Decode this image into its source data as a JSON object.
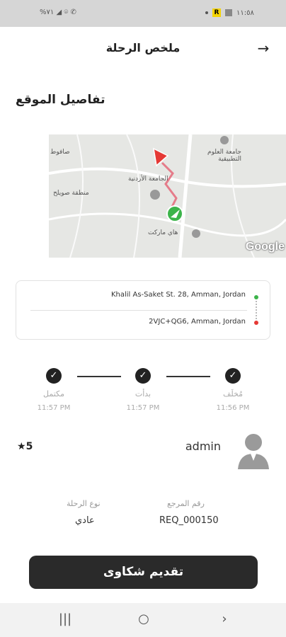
{
  "status_bar": {
    "time": "١١:٥٨",
    "left_indicators": "%٧١ ◢ ⌾ ✆"
  },
  "header": {
    "title": "ملخص الرحلة",
    "back_icon": "arrow-right-icon"
  },
  "location_section": {
    "title": "تفاصيل الموقع"
  },
  "map": {
    "labels": {
      "university_sci": "جامعة العلوم التطبيقية",
      "university_jordan": "الجامعة الأردنية",
      "sweileh": "منطقة صويلح",
      "safout": "صافوط",
      "hi_market": "هاي ماركت"
    },
    "attribution": "Google"
  },
  "route": {
    "pickup": "Khalil As-Saket St. 28, Amman, Jordan",
    "dropoff": "2VJC+QG6, Amman, Jordan",
    "pickup_color": "#3cb44a",
    "dropoff_color": "#e53935"
  },
  "steps": [
    {
      "label": "مُخلَف",
      "time": "11:56 PM"
    },
    {
      "label": "بدأت",
      "time": "11:57 PM"
    },
    {
      "label": "مكتمل",
      "time": "11:57 PM"
    }
  ],
  "driver": {
    "name": "admin",
    "rating": "5"
  },
  "details": {
    "reference_label": "رقم المرجع",
    "reference_value": "REQ_000150",
    "trip_type_label": "نوع الرحلة",
    "trip_type_value": "عادي"
  },
  "complaint_button": {
    "label": "تقديم شكاوى"
  },
  "accent_color": "#2a2a2a"
}
